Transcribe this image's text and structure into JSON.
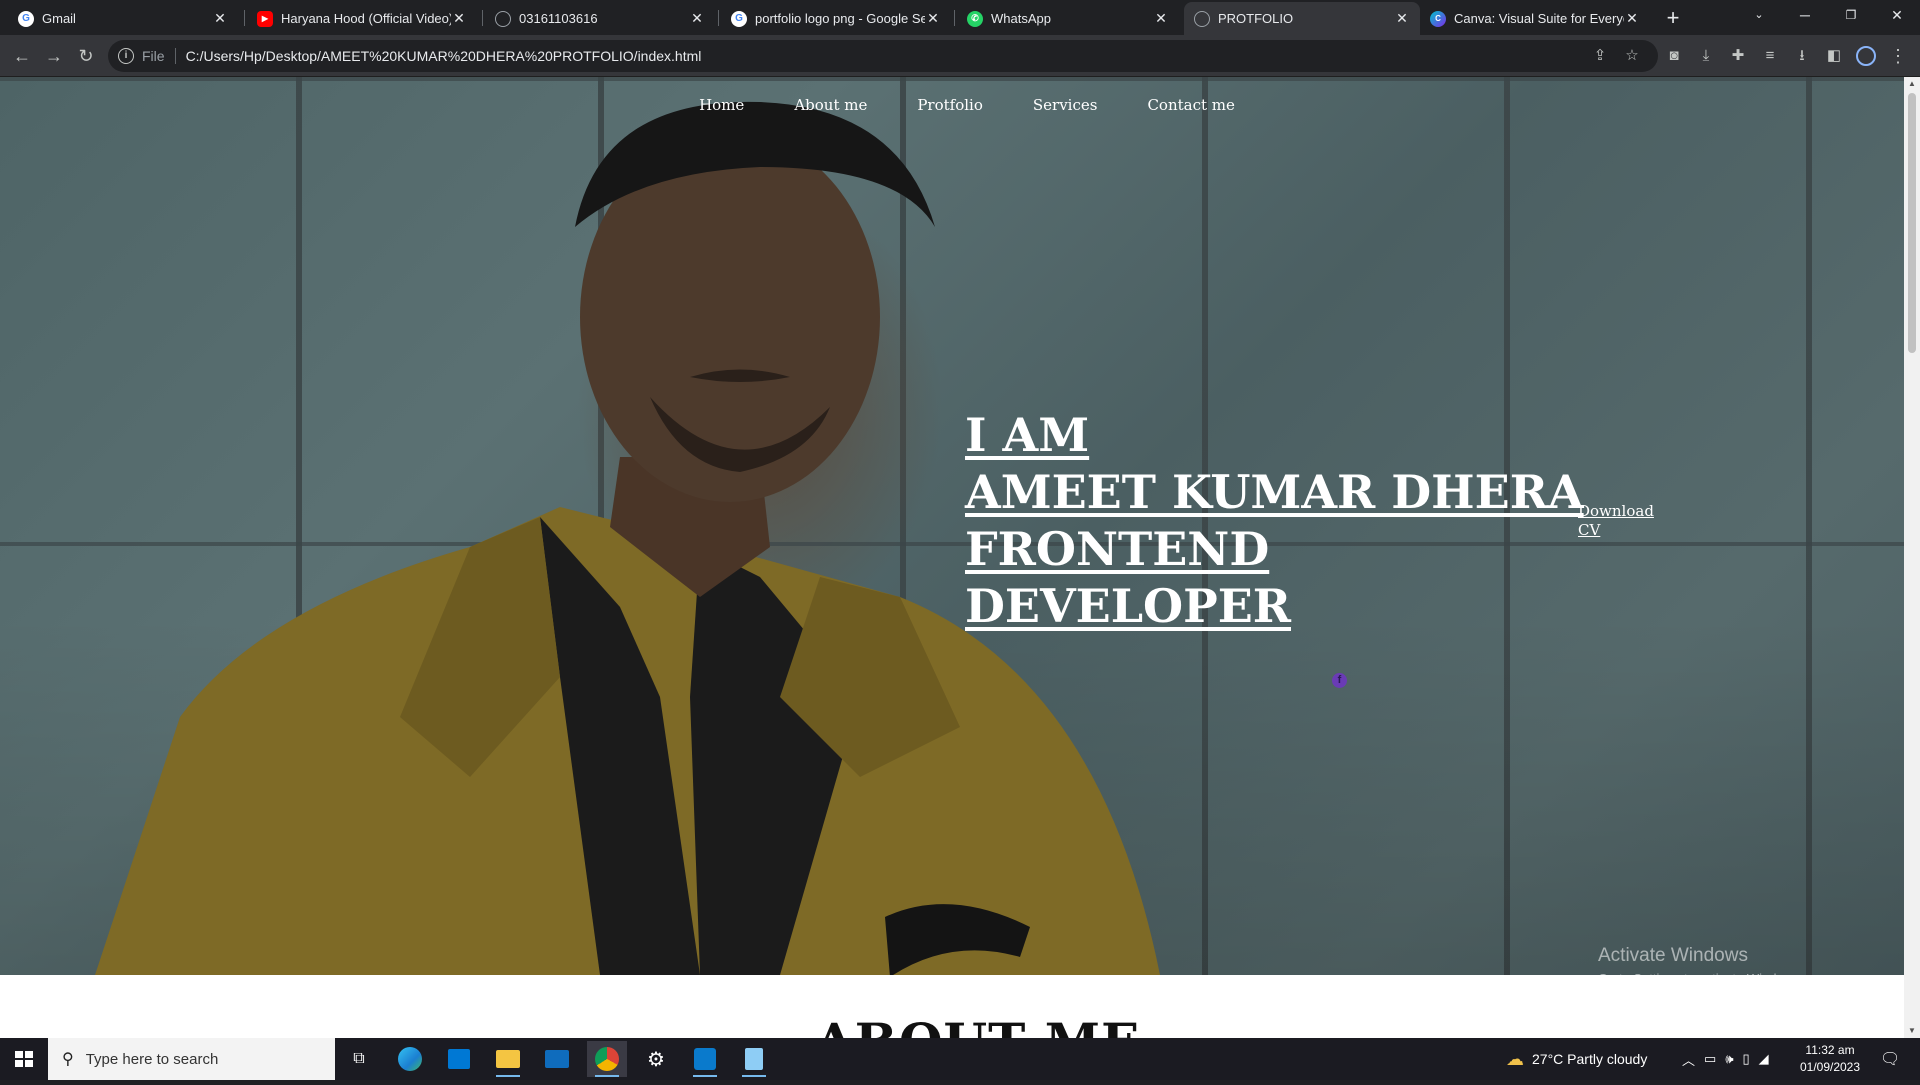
{
  "browser": {
    "tabs": [
      {
        "title": "Gmail",
        "icon": "google-icon"
      },
      {
        "title": "Haryana Hood (Official Video) I",
        "icon": "youtube-icon"
      },
      {
        "title": "03161103616",
        "icon": "globe-icon"
      },
      {
        "title": "portfolio logo png - Google Sea",
        "icon": "google-icon"
      },
      {
        "title": "WhatsApp",
        "icon": "whatsapp-icon"
      },
      {
        "title": "PROTFOLIO",
        "icon": "globe-icon",
        "active": true
      },
      {
        "title": "Canva: Visual Suite for Everyone",
        "icon": "canva-icon"
      }
    ],
    "address": {
      "scheme": "File",
      "url": "C:/Users/Hp/Desktop/AMEET%20KUMAR%20DHERA%20PROTFOLIO/index.html"
    }
  },
  "page": {
    "nav": [
      "Home",
      "About me",
      "Protfolio",
      "Services",
      "Contact me"
    ],
    "hero": {
      "line1": "I AM",
      "line2": "AMEET KUMAR DHERA",
      "line3": "FRONTEND",
      "line4": "DEVELOPER",
      "download": "Download CV"
    },
    "about_heading": "ABOUT ME"
  },
  "watermark": {
    "title": "Activate Windows",
    "subtitle": "Go to Settings to activate Windows."
  },
  "taskbar": {
    "search_placeholder": "Type here to search",
    "weather": "27°C  Partly cloudy",
    "time": "11:32 am",
    "date": "01/09/2023"
  },
  "colors": {
    "accent": "#76b9ed",
    "hero_overlay": "#4e6466",
    "jacket": "#b3911f"
  }
}
